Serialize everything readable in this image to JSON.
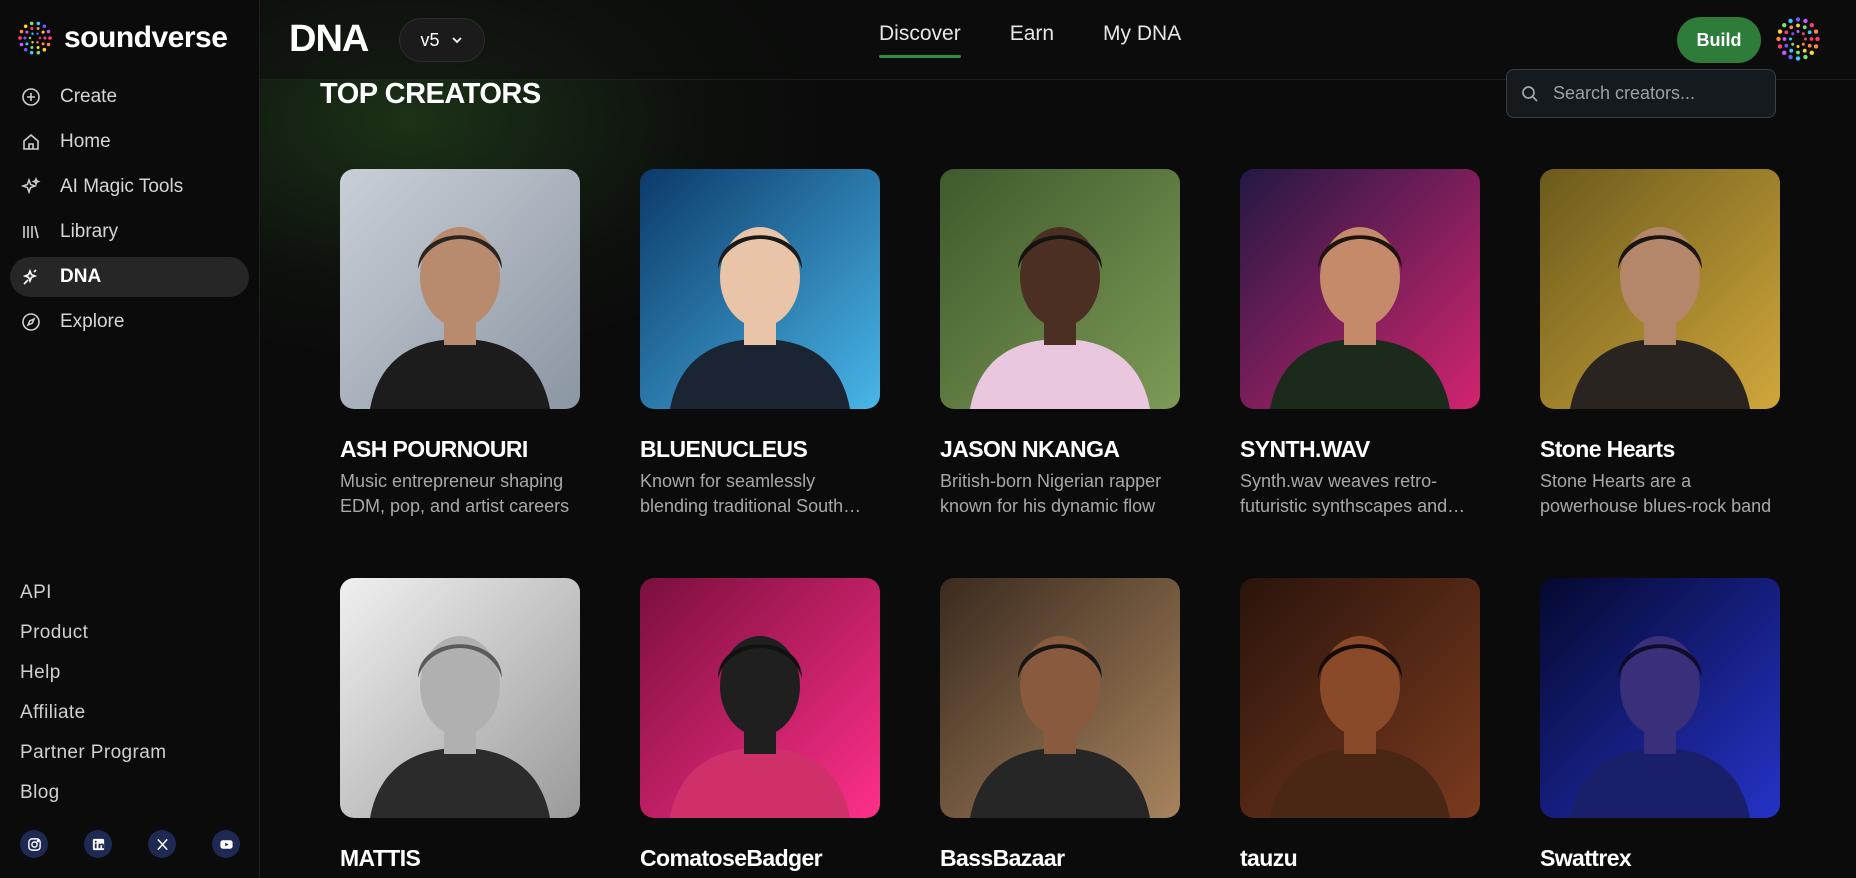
{
  "brand": {
    "name": "soundverse"
  },
  "sidebar": {
    "items": [
      {
        "label": "Create",
        "icon": "plus-circle-icon"
      },
      {
        "label": "Home",
        "icon": "home-icon"
      },
      {
        "label": "AI Magic Tools",
        "icon": "sparkle-icon"
      },
      {
        "label": "Library",
        "icon": "library-icon"
      },
      {
        "label": "DNA",
        "icon": "dna-sparkle-icon",
        "active": true
      },
      {
        "label": "Explore",
        "icon": "compass-icon"
      }
    ],
    "footer_links": [
      "API",
      "Product",
      "Help",
      "Affiliate",
      "Partner Program",
      "Blog"
    ],
    "socials": [
      "instagram-icon",
      "linkedin-icon",
      "x-icon",
      "youtube-icon"
    ]
  },
  "header": {
    "title": "DNA",
    "version": "v5",
    "tabs": [
      {
        "label": "Discover",
        "active": true
      },
      {
        "label": "Earn",
        "active": false
      },
      {
        "label": "My DNA",
        "active": false
      }
    ],
    "build_label": "Build"
  },
  "section": {
    "title_light": "TOP",
    "title_bold": "CREATORS",
    "search_placeholder": "Search creators..."
  },
  "creators": [
    {
      "name": "ASH POURNOURI",
      "desc": "Music entrepreneur shaping EDM, pop, and artist careers"
    },
    {
      "name": "BLUENUCLEUS",
      "desc": "Known for seamlessly blending traditional South Asian sounds"
    },
    {
      "name": "JASON NKANGA",
      "desc": "British-born Nigerian rapper known for his dynamic flow"
    },
    {
      "name": "SYNTH.WAV",
      "desc": "Synth.wav weaves retro-futuristic synthscapes and beats"
    },
    {
      "name": "Stone Hearts",
      "desc": "Stone Hearts are a powerhouse blues-rock band"
    },
    {
      "name": "MATTIS",
      "desc": ""
    },
    {
      "name": "ComatoseBadger",
      "desc": ""
    },
    {
      "name": "BassBazaar",
      "desc": ""
    },
    {
      "name": "tauzu",
      "desc": ""
    },
    {
      "name": "Swattrex",
      "desc": ""
    }
  ],
  "colors": {
    "accent_green": "#2d7c3a",
    "tab_underline": "#2f8f3e",
    "background": "#0b0b0b"
  }
}
